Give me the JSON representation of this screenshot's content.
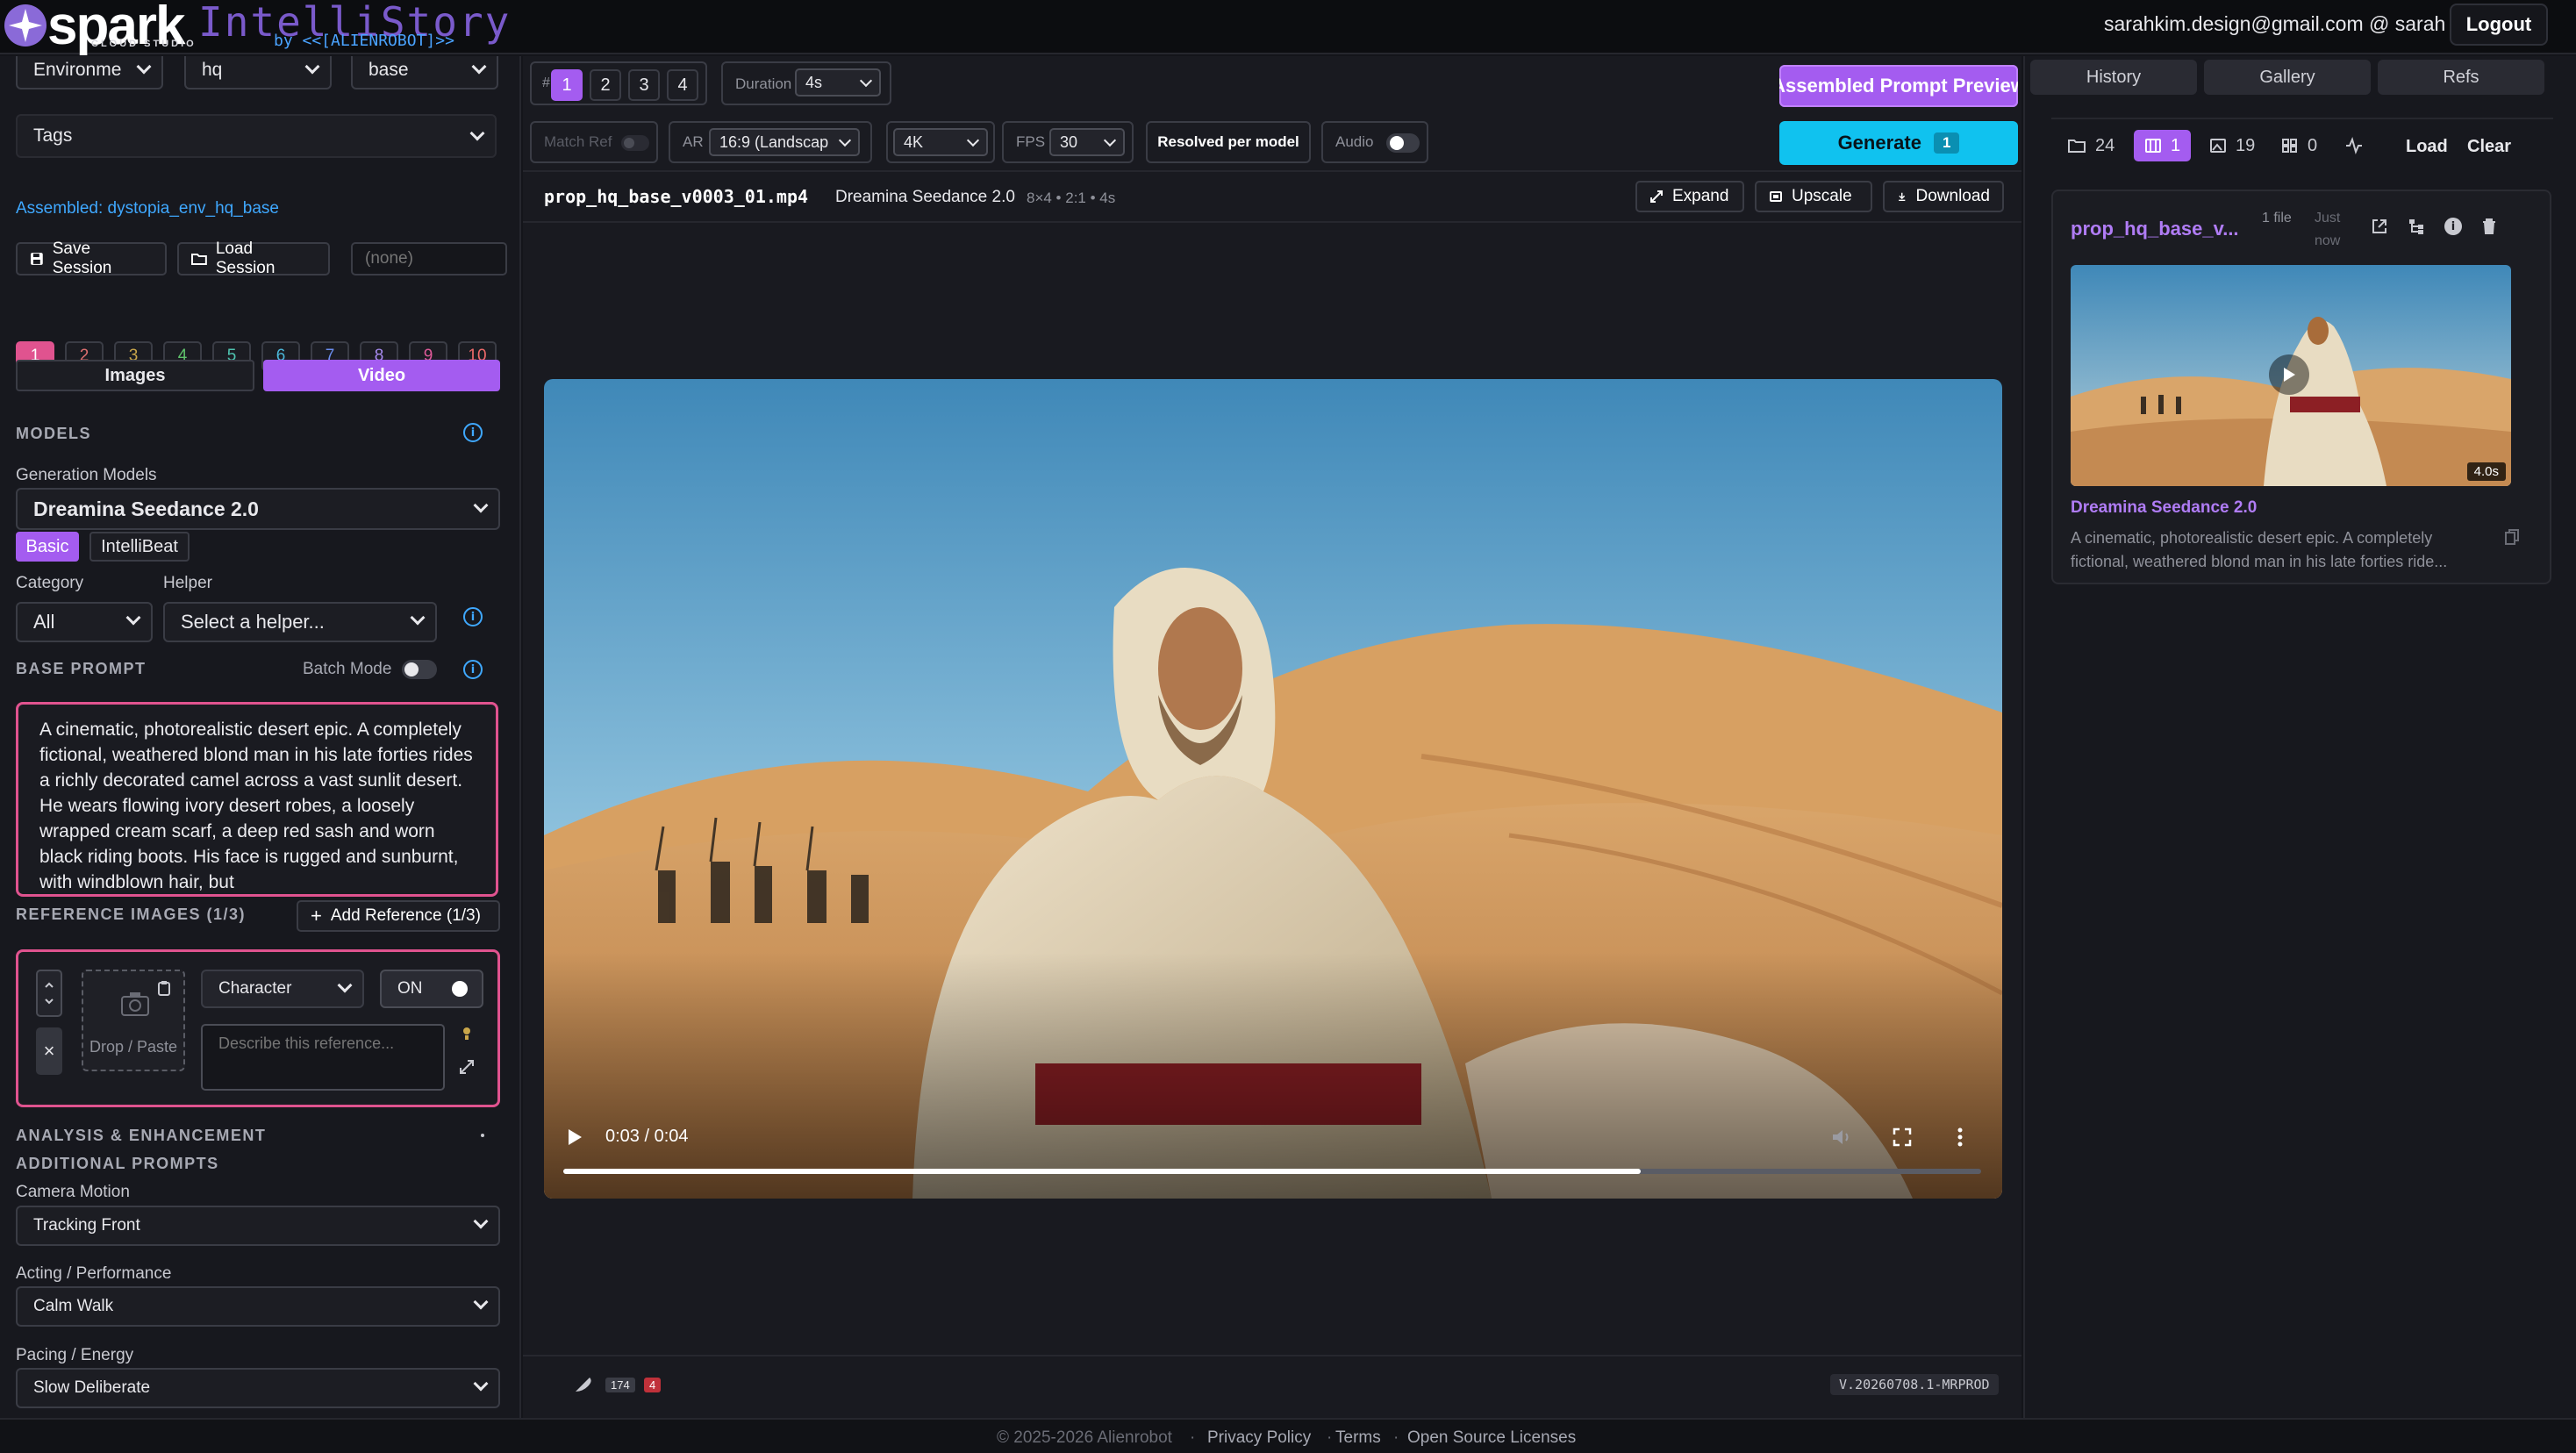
{
  "brand": {
    "name": "spark",
    "subtitle": "CLOUD STUDIO",
    "product": "IntelliStory",
    "by": "by <<[ALIENROBOT]>>"
  },
  "header": {
    "user_email": "sarahkim.design@gmail.com @ sarah",
    "logout_label": "Logout"
  },
  "left": {
    "top_selects": [
      "Environme",
      "hq",
      "base"
    ],
    "tags_label": "Tags",
    "assembled_text": "Assembled: dystopia_env_hq_base",
    "save_session_label": "Save Session",
    "load_session_label": "Load Session",
    "session_placeholder": "(none)",
    "slots": [
      {
        "n": "1",
        "color": "#e0538f"
      },
      {
        "n": "2",
        "color": "#e07070"
      },
      {
        "n": "3",
        "color": "#c9a64a"
      },
      {
        "n": "4",
        "color": "#5fc26b"
      },
      {
        "n": "5",
        "color": "#4fc4b0"
      },
      {
        "n": "6",
        "color": "#4ab6d8"
      },
      {
        "n": "7",
        "color": "#6b8ef0"
      },
      {
        "n": "8",
        "color": "#a78af0"
      },
      {
        "n": "9",
        "color": "#e05a9a"
      },
      {
        "n": "10",
        "color": "#f06a6a"
      }
    ],
    "mode_tabs": {
      "images": "Images",
      "video": "Video"
    },
    "models_section": "MODELS",
    "generation_models_label": "Generation Models",
    "generation_model_value": "Dreamina Seedance 2.0",
    "subtabs": {
      "basic": "Basic",
      "intellibeat": "IntelliBeat"
    },
    "category_label": "Category",
    "category_value": "All",
    "helper_label": "Helper",
    "helper_value": "Select a helper...",
    "base_prompt_section": "BASE PROMPT",
    "batch_mode_label": "Batch Mode",
    "base_prompt_text": "A cinematic, photorealistic desert epic. A completely fictional, weathered blond man in his late forties rides a richly decorated camel across a vast sunlit desert. He wears flowing ivory desert robes, a loosely wrapped cream scarf, a deep red sash and worn black riding boots. His face is rugged and sunburnt, with windblown hair, but",
    "reference_section": "REFERENCE IMAGES (1/3)",
    "add_reference_label": "Add Reference (1/3)",
    "reference": {
      "drop_label": "Drop / Paste",
      "type_value": "Character",
      "on_label": "ON",
      "describe_placeholder": "Describe this reference..."
    },
    "analysis_section": "ANALYSIS & ENHANCEMENT",
    "additional_section": "ADDITIONAL PROMPTS",
    "camera_motion_label": "Camera Motion",
    "camera_motion_value": "Tracking Front",
    "acting_label": "Acting / Performance",
    "acting_value": "Calm Walk",
    "pacing_label": "Pacing / Energy",
    "pacing_value": "Slow Deliberate"
  },
  "center": {
    "hash_label": "#",
    "count_buttons": [
      "1",
      "2",
      "3",
      "4"
    ],
    "duration_label": "Duration",
    "duration_value": "4s",
    "assembled_preview_label": "Assembled Prompt Preview",
    "match_ref_label": "Match Ref",
    "ar_label": "AR",
    "ar_value": "16:9 (Landscap",
    "resolution_value": "4K",
    "fps_label": "FPS",
    "fps_value": "30",
    "resolved_label": "Resolved per model",
    "audio_label": "Audio",
    "generate_label": "Generate",
    "generate_count": "1",
    "file_name": "prop_hq_base_v0003_01.mp4",
    "file_model": "Dreamina Seedance 2.0",
    "file_meta": "8×4 • 2:1 • 4s",
    "expand_label": "Expand",
    "upscale_label": "Upscale",
    "download_label": "Download",
    "video_time": "0:03 / 0:04",
    "video_progress": 0.76,
    "status_counts": [
      "174",
      "4"
    ],
    "version": "V.20260708.1-MRPROD"
  },
  "right": {
    "tabs": [
      "History",
      "Gallery",
      "Refs"
    ],
    "stats": {
      "folders": "24",
      "videos": "1",
      "images": "19",
      "grid": "0"
    },
    "load_label": "Load",
    "clear_label": "Clear",
    "card": {
      "title": "prop_hq_base_v...",
      "files": "1 file",
      "time": "Just now",
      "duration_badge": "4.0s",
      "model": "Dreamina Seedance 2.0",
      "description": "A cinematic, photorealistic desert epic. A completely fictional, weathered blond man in his late forties ride..."
    }
  },
  "footer": {
    "copyright": "© 2025-2026 Alienrobot",
    "links": [
      "Privacy Policy",
      "Terms",
      "Open Source Licenses"
    ]
  },
  "colors": {
    "accent_purple": "#a45cf0",
    "generate_cyan": "#10c2ef",
    "link_blue": "#3fa8ff",
    "pink_border": "#e0538f"
  }
}
